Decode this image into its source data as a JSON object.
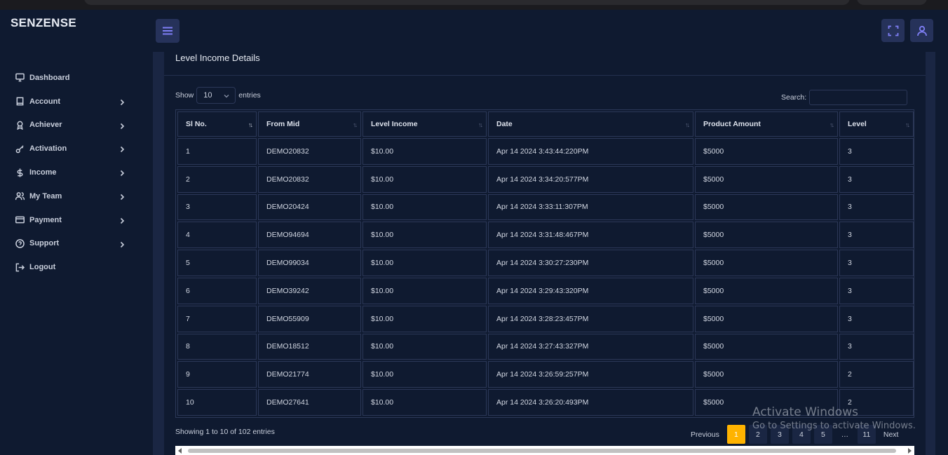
{
  "brand": "SENZENSE",
  "sidebar": {
    "items": [
      {
        "label": "Dashboard",
        "icon": "monitor-icon",
        "has_submenu": false
      },
      {
        "label": "Account",
        "icon": "book-icon",
        "has_submenu": true
      },
      {
        "label": "Achiever",
        "icon": "award-icon",
        "has_submenu": true
      },
      {
        "label": "Activation",
        "icon": "key-icon",
        "has_submenu": true
      },
      {
        "label": "Income",
        "icon": "dollar-icon",
        "has_submenu": true
      },
      {
        "label": "My Team",
        "icon": "users-icon",
        "has_submenu": true
      },
      {
        "label": "Payment",
        "icon": "credit-card-icon",
        "has_submenu": true
      },
      {
        "label": "Support",
        "icon": "help-circle-icon",
        "has_submenu": true
      },
      {
        "label": "Logout",
        "icon": "logout-icon",
        "has_submenu": false
      }
    ]
  },
  "topbar": {
    "menu_icon": "hamburger-icon",
    "fullscreen_icon": "fullscreen-icon",
    "profile_icon": "user-icon"
  },
  "card": {
    "title": "Level Income Details"
  },
  "table_controls": {
    "show_label": "Show",
    "page_length": "10",
    "entries_label": "entries",
    "search_label": "Search:",
    "search_value": ""
  },
  "table": {
    "columns": [
      "Sl No.",
      "From Mid",
      "Level Income",
      "Date",
      "Product Amount",
      "Level"
    ],
    "rows": [
      [
        "1",
        "DEMO20832",
        "$10.00",
        "Apr 14 2024 3:43:44:220PM",
        "$5000",
        "3"
      ],
      [
        "2",
        "DEMO20832",
        "$10.00",
        "Apr 14 2024 3:34:20:577PM",
        "$5000",
        "3"
      ],
      [
        "3",
        "DEMO20424",
        "$10.00",
        "Apr 14 2024 3:33:11:307PM",
        "$5000",
        "3"
      ],
      [
        "4",
        "DEMO94694",
        "$10.00",
        "Apr 14 2024 3:31:48:467PM",
        "$5000",
        "3"
      ],
      [
        "5",
        "DEMO99034",
        "$10.00",
        "Apr 14 2024 3:30:27:230PM",
        "$5000",
        "3"
      ],
      [
        "6",
        "DEMO39242",
        "$10.00",
        "Apr 14 2024 3:29:43:320PM",
        "$5000",
        "3"
      ],
      [
        "7",
        "DEMO55909",
        "$10.00",
        "Apr 14 2024 3:28:23:457PM",
        "$5000",
        "3"
      ],
      [
        "8",
        "DEMO18512",
        "$10.00",
        "Apr 14 2024 3:27:43:327PM",
        "$5000",
        "3"
      ],
      [
        "9",
        "DEMO21774",
        "$10.00",
        "Apr 14 2024 3:26:59:257PM",
        "$5000",
        "2"
      ],
      [
        "10",
        "DEMO27641",
        "$10.00",
        "Apr 14 2024 3:26:20:493PM",
        "$5000",
        "2"
      ]
    ]
  },
  "footer": {
    "info": "Showing 1 to 10 of 102 entries",
    "pagination": [
      "Previous",
      "1",
      "2",
      "3",
      "4",
      "5",
      "…",
      "11",
      "Next"
    ],
    "active_page": "1"
  },
  "watermark": {
    "line1": "Activate Windows",
    "line2": "Go to Settings to activate Windows."
  },
  "colors": {
    "background": "#0f1a30",
    "accent": "#7f7ff5",
    "active_page": "#ffb300"
  }
}
